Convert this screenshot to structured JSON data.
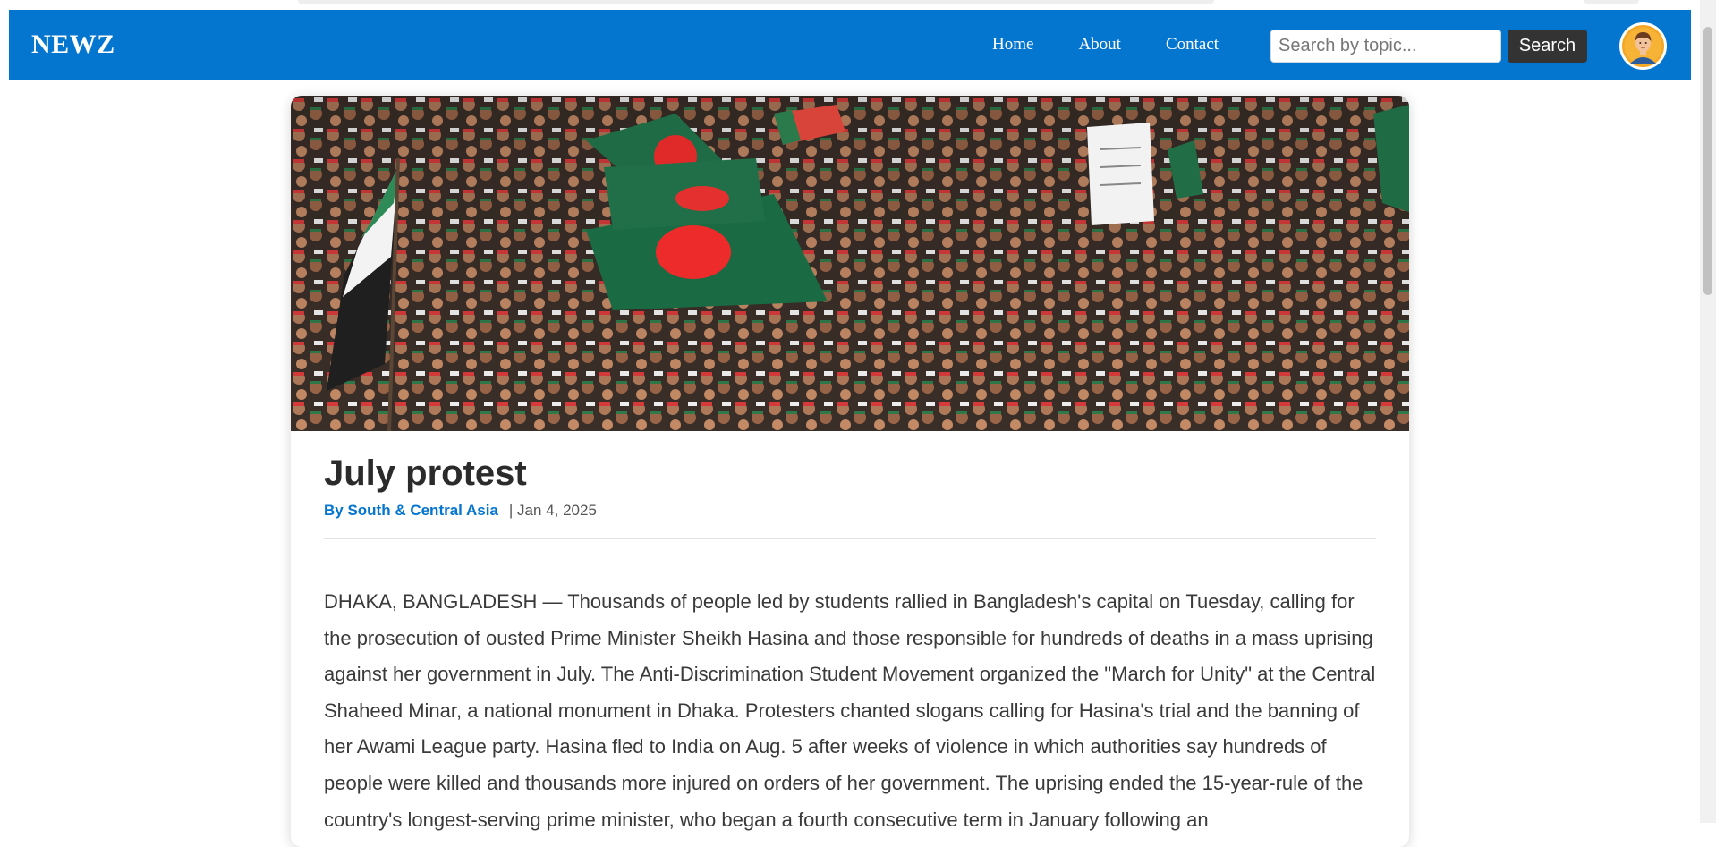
{
  "navbar": {
    "brand": "NEWZ",
    "links": [
      "Home",
      "About",
      "Contact"
    ],
    "search_placeholder": "Search by topic...",
    "search_button": "Search",
    "accent_color": "#0476d0"
  },
  "article": {
    "title": "July protest",
    "author": "By South & Central Asia",
    "date": "| Jan 4, 2025",
    "image_description_icon": "protest-photo",
    "body": "DHAKA, BANGLADESH — Thousands of people led by students rallied in Bangladesh's capital on Tuesday, calling for the prosecution of ousted Prime Minister Sheikh Hasina and those responsible for hundreds of deaths in a mass uprising against her government in July. The Anti-Discrimination Student Movement organized the \"March for Unity\" at the Central Shaheed Minar, a national monument in Dhaka. Protesters chanted slogans calling for Hasina's trial and the banning of her Awami League party. Hasina fled to India on Aug. 5 after weeks of violence in which authorities say hundreds of people were killed and thousands more injured on orders of her government. The uprising ended the 15-year-rule of the country's longest-serving prime minister, who began a fourth consecutive term in January following an"
  }
}
